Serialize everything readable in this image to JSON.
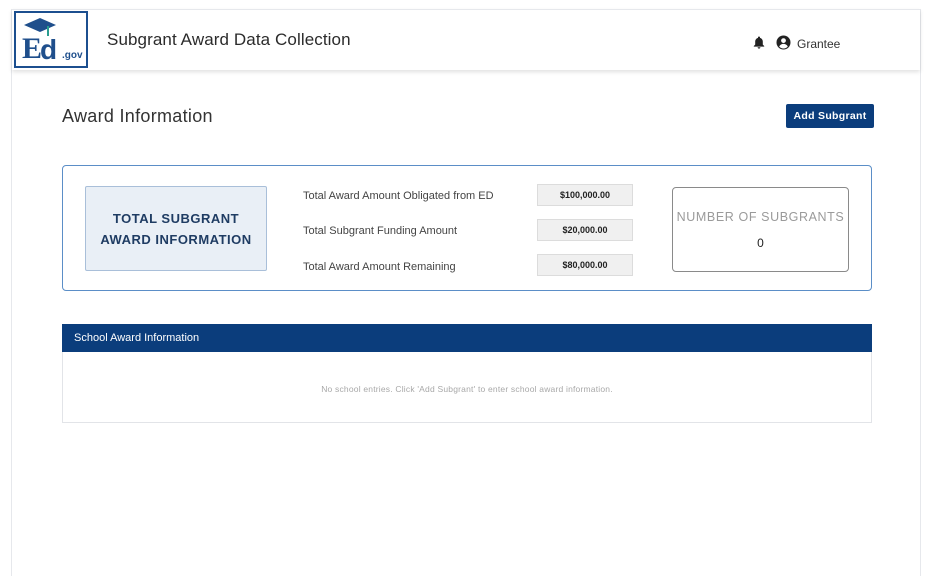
{
  "header": {
    "logo_text": "Ed.gov",
    "app_title": "Subgrant Award Data Collection",
    "user_name": "Grantee",
    "icons": [
      "bell-icon",
      "user-circle-icon"
    ]
  },
  "page": {
    "title": "Award Information",
    "add_button_label": "Add Subgrant"
  },
  "summary": {
    "total_box_label": "TOTAL SUBGRANT AWARD INFORMATION",
    "rows": [
      {
        "label": "Total Award Amount Obligated from ED",
        "value": "$100,000.00"
      },
      {
        "label": "Total Subgrant Funding Amount",
        "value": "$20,000.00"
      },
      {
        "label": "Total Award Amount Remaining",
        "value": "$80,000.00"
      }
    ],
    "count_label": "NUMBER OF SUBGRANTS",
    "count_value": "0"
  },
  "school": {
    "header": "School Award Information",
    "empty_message": "No school entries. Click 'Add Subgrant' to enter school award information."
  },
  "colors": {
    "primary": "#0b3d7c",
    "card_border": "#5b8ec7",
    "total_box_bg": "#e9eff6"
  }
}
